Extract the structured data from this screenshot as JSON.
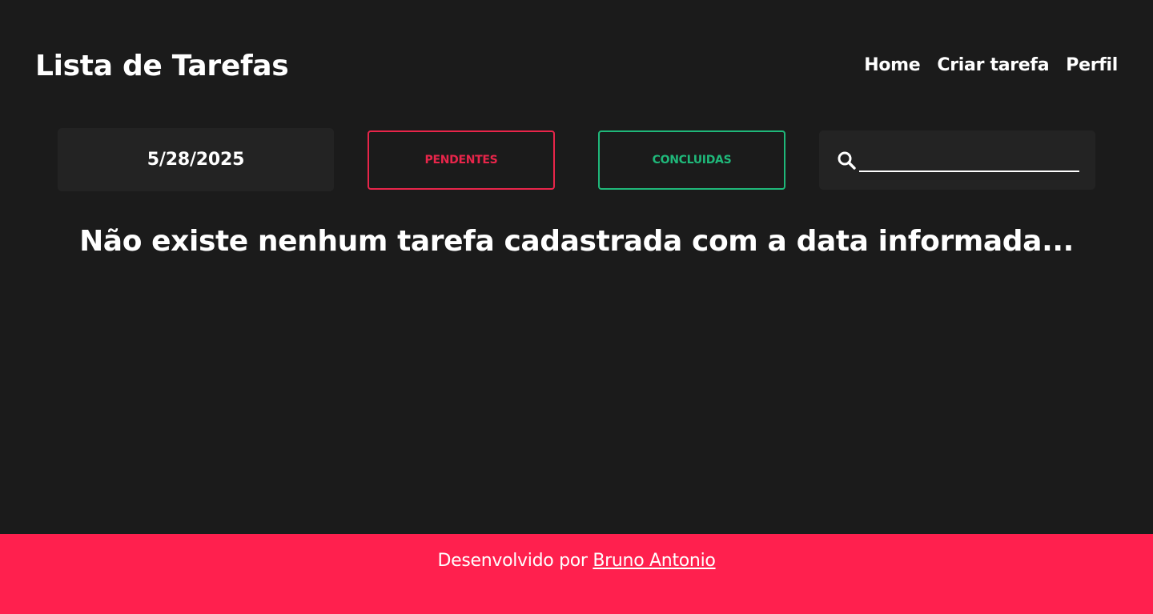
{
  "header": {
    "title": "Lista de Tarefas",
    "nav": {
      "home": "Home",
      "create": "Criar tarefa",
      "profile": "Perfil"
    }
  },
  "filters": {
    "date": "5/28/2025",
    "pending_label": "PENDENTES",
    "done_label": "CONCLUIDAS",
    "search": {
      "value": "",
      "placeholder": "",
      "icon": "search-icon"
    }
  },
  "main": {
    "empty_message": "Não existe nenhum tarefa cadastrada com a data informada..."
  },
  "footer": {
    "prefix": "Desenvolvido por",
    "author": "Bruno Antonio"
  },
  "colors": {
    "background": "#1b1b1b",
    "panel": "#232323",
    "accent": "#ff204e",
    "pending": "#e8254a",
    "done": "#1fb87a"
  }
}
